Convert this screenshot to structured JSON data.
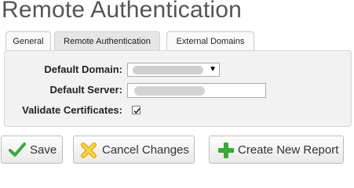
{
  "page": {
    "title": "Remote Authentication"
  },
  "tabs": [
    {
      "label": "General",
      "active": false
    },
    {
      "label": "Remote Authentication",
      "active": true
    },
    {
      "label": "External Domains",
      "active": false
    }
  ],
  "form": {
    "default_domain": {
      "label": "Default Domain:",
      "value_redacted": true
    },
    "default_server": {
      "label": "Default Server:",
      "value_redacted": true
    },
    "validate_certificates": {
      "label": "Validate Certificates:",
      "checked": true
    }
  },
  "actions": {
    "save": {
      "label": "Save",
      "icon": "checkmark-icon",
      "color": "#3aa83a"
    },
    "cancel": {
      "label": "Cancel Changes",
      "icon": "cancel-x-icon",
      "color": "#f0c419"
    },
    "create_report": {
      "label": "Create New Report",
      "icon": "plus-icon",
      "color": "#3aa83a"
    }
  }
}
